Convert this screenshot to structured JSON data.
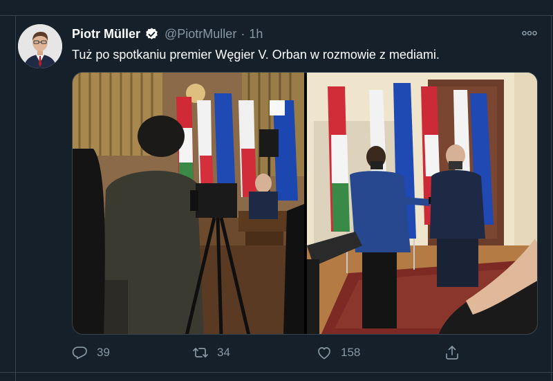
{
  "tweet": {
    "author_name": "Piotr Müller",
    "handle": "@PiotrMuller",
    "separator": "·",
    "time": "1h",
    "text": "Tuż po spotkaniu premier Węgier V. Orban w rozmowie z mediami.",
    "verified": true
  },
  "actions": {
    "reply_count": "39",
    "retweet_count": "34",
    "like_count": "158"
  },
  "icons": {
    "verified": "verified-badge-icon",
    "more": "more-options-icon",
    "reply": "reply-icon",
    "retweet": "retweet-icon",
    "like": "heart-icon",
    "share": "share-icon"
  },
  "colors": {
    "background": "#15202b",
    "border": "#38444d",
    "secondary_text": "#8899a6",
    "primary_text": "#ffffff"
  }
}
